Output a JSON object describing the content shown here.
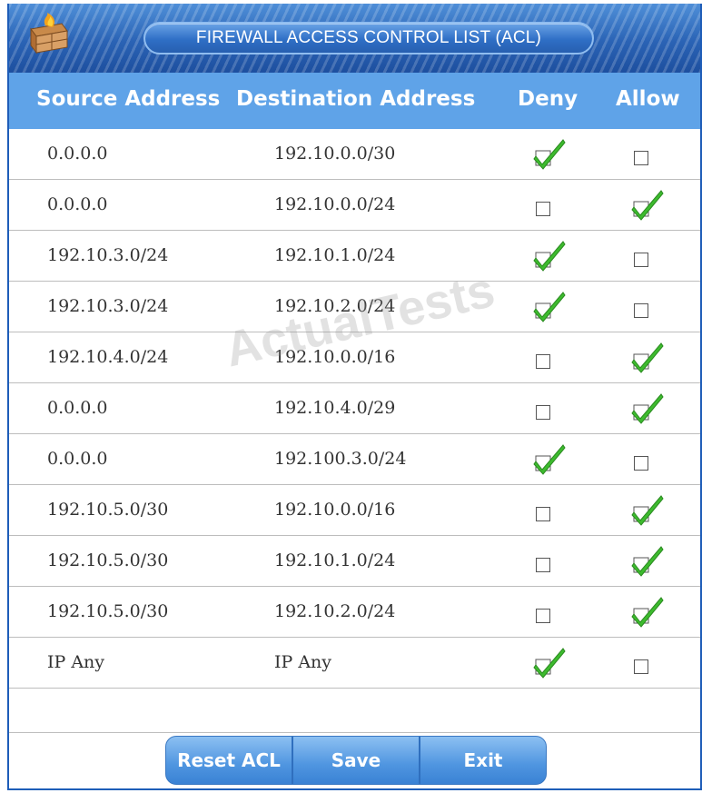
{
  "window": {
    "title": "FIREWALL ACCESS CONTROL LIST (ACL)",
    "icon": "firewall-icon"
  },
  "table": {
    "headers": {
      "source": "Source Address",
      "destination": "Destination Address",
      "deny": "Deny",
      "allow": "Allow"
    },
    "rows": [
      {
        "source": "0.0.0.0",
        "destination": "192.10.0.0/30",
        "deny": true,
        "allow": false
      },
      {
        "source": "0.0.0.0",
        "destination": "192.10.0.0/24",
        "deny": false,
        "allow": true
      },
      {
        "source": "192.10.3.0/24",
        "destination": "192.10.1.0/24",
        "deny": true,
        "allow": false
      },
      {
        "source": "192.10.3.0/24",
        "destination": "192.10.2.0/24",
        "deny": true,
        "allow": false
      },
      {
        "source": "192.10.4.0/24",
        "destination": "192.10.0.0/16",
        "deny": false,
        "allow": true
      },
      {
        "source": "0.0.0.0",
        "destination": "192.10.4.0/29",
        "deny": false,
        "allow": true
      },
      {
        "source": "0.0.0.0",
        "destination": "192.100.3.0/24",
        "deny": true,
        "allow": false
      },
      {
        "source": "192.10.5.0/30",
        "destination": "192.10.0.0/16",
        "deny": false,
        "allow": true
      },
      {
        "source": "192.10.5.0/30",
        "destination": "192.10.1.0/24",
        "deny": false,
        "allow": true
      },
      {
        "source": "192.10.5.0/30",
        "destination": "192.10.2.0/24",
        "deny": false,
        "allow": true
      },
      {
        "source": "IP Any",
        "destination": "IP Any",
        "deny": true,
        "allow": false
      }
    ]
  },
  "buttons": {
    "reset": "Reset ACL",
    "save": "Save",
    "exit": "Exit"
  },
  "watermark": "ActualTests",
  "colors": {
    "titlebar": "#2a63b5",
    "header": "#5fa3e8",
    "check": "#3dbb2e",
    "button": "#4f95e0"
  }
}
